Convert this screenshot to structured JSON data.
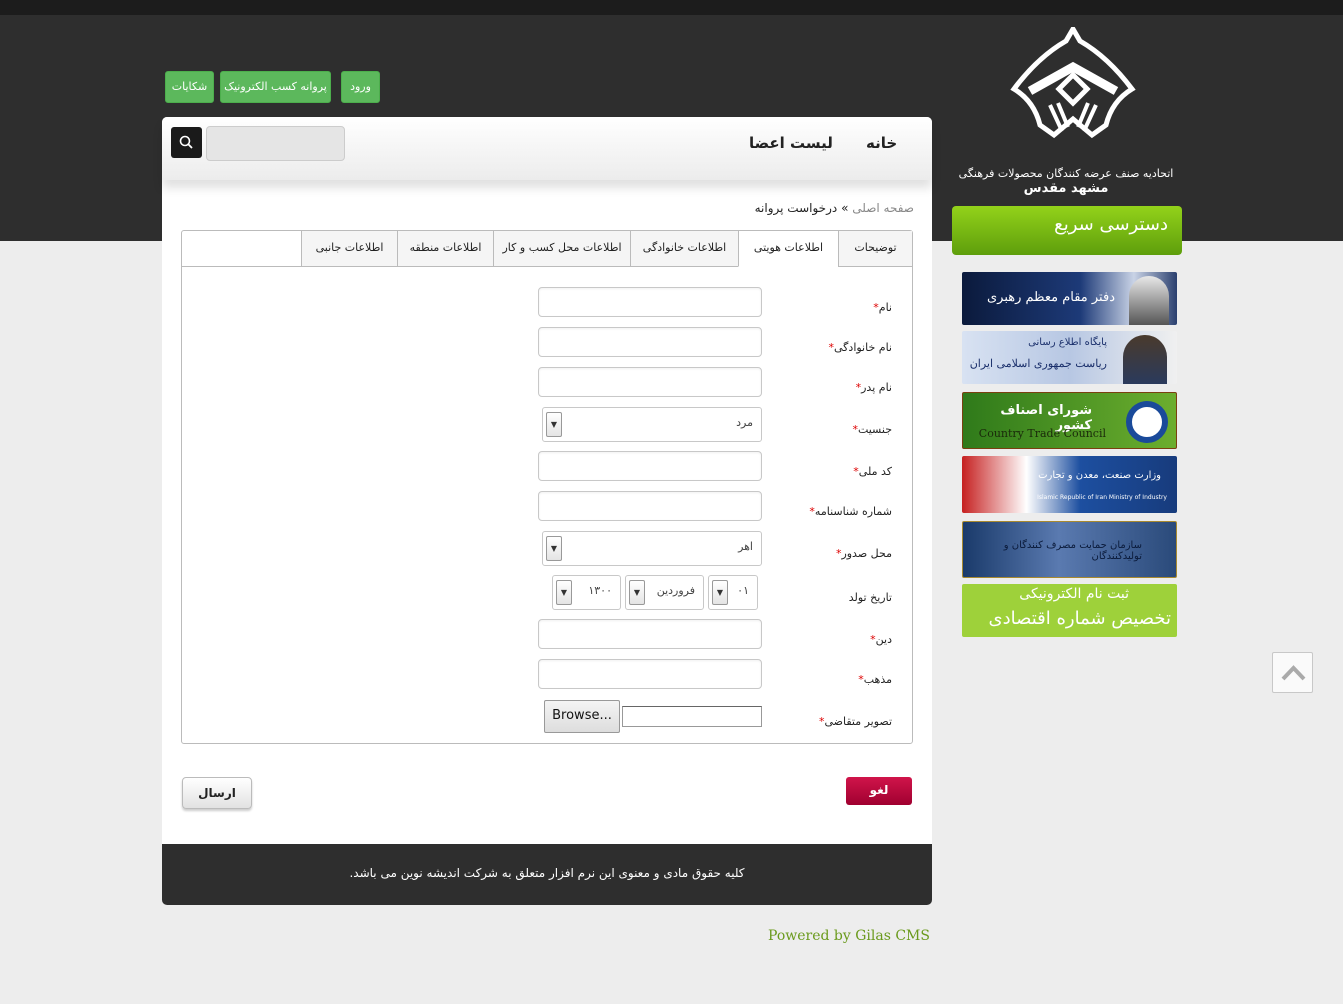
{
  "header": {
    "org_line1": "اتحادیه صنف عرضه کنندگان محصولات فرهنگی",
    "org_line2": "مشهد مقدس",
    "quick_access": "دسترسی سریع"
  },
  "top_buttons": {
    "login": "ورود",
    "license": "پروانه کسب الکترونیک",
    "complaints": "شکایات"
  },
  "nav": {
    "home": "خانه",
    "members": "لیست اعضا",
    "search_placeholder": ""
  },
  "breadcrumb": {
    "home": "صفحه اصلی",
    "separator": "»",
    "current": "درخواست پروانه"
  },
  "tabs": [
    {
      "label": "توضیحات"
    },
    {
      "label": "اطلاعات هویتی"
    },
    {
      "label": "اطلاعات خانوادگی"
    },
    {
      "label": "اطلاعات محل کسب و کار"
    },
    {
      "label": "اطلاعات منطقه"
    },
    {
      "label": "اطلاعات جانبی"
    }
  ],
  "form": {
    "first_name": "نام",
    "last_name": "نام خانوادگی",
    "father_name": "نام پدر",
    "gender": "جنسیت",
    "gender_value": "مرد",
    "national_code": "کد ملی",
    "id_number": "شماره شناسنامه",
    "issue_place": "محل صدور",
    "issue_place_value": "اهر",
    "birth_date": "تاریخ تولد",
    "birth_day": "۰۱",
    "birth_month": "فروردین",
    "birth_year": "۱۳۰۰",
    "religion": "دین",
    "sect": "مذهب",
    "photo": "تصویر متقاضی",
    "browse": "Browse...",
    "required_mark": "*"
  },
  "actions": {
    "cancel": "لغو",
    "submit": "ارسال"
  },
  "footer": {
    "copyright": "کلیه حقوق مادی و معنوی این نرم افزار متعلق به شرکت اندیشه نوین می باشد.",
    "powered": "Powered by Gilas CMS"
  },
  "sidebar_banners": {
    "leader": "دفتر مقام معظم رهبری",
    "president_top": "پایگاه اطلاع رسانی",
    "president_bottom": "ریاست جمهوری اسلامی ایران",
    "council_fa": "شورای اصناف کشور",
    "council_en": "Country Trade Council",
    "ministry_fa": "وزارت صنعت، معدن و تجارت",
    "ministry_en": "Islamic Republic of Iran Ministry of Industry",
    "support_org": "سازمان حمایت مصرف کنندگان و تولیدکنندگان",
    "econ_line1": "ثبت نام الکترونیکی",
    "econ_line2": "تخصیص شماره اقتصادی"
  },
  "colors": {
    "accent_green": "#5cb85c",
    "quick_access_green": "#7cbc14",
    "cancel_red": "#c0103d",
    "header_dark": "#2e2e2e"
  }
}
